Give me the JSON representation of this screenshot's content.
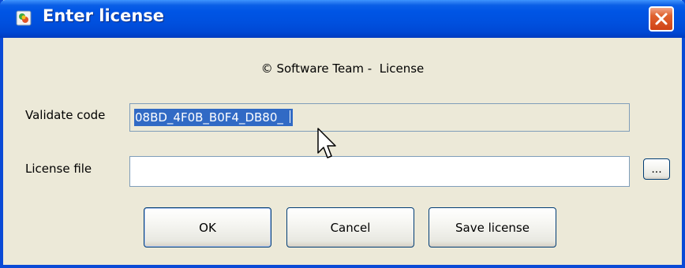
{
  "window": {
    "title": "Enter license",
    "icon": "app-icon",
    "close_icon": "close-icon"
  },
  "header": {
    "copyright": "© Software Team -  License"
  },
  "form": {
    "validate_label": "Validate code",
    "validate_value": "08BD_4F0B_B0F4_DB80_",
    "license_file_label": "License file",
    "license_file_value": "",
    "browse_label": "..."
  },
  "buttons": {
    "ok": "OK",
    "cancel": "Cancel",
    "save": "Save license"
  },
  "colors": {
    "titlebar": "#0055e5",
    "selection": "#316ac5",
    "close": "#e0622f"
  }
}
